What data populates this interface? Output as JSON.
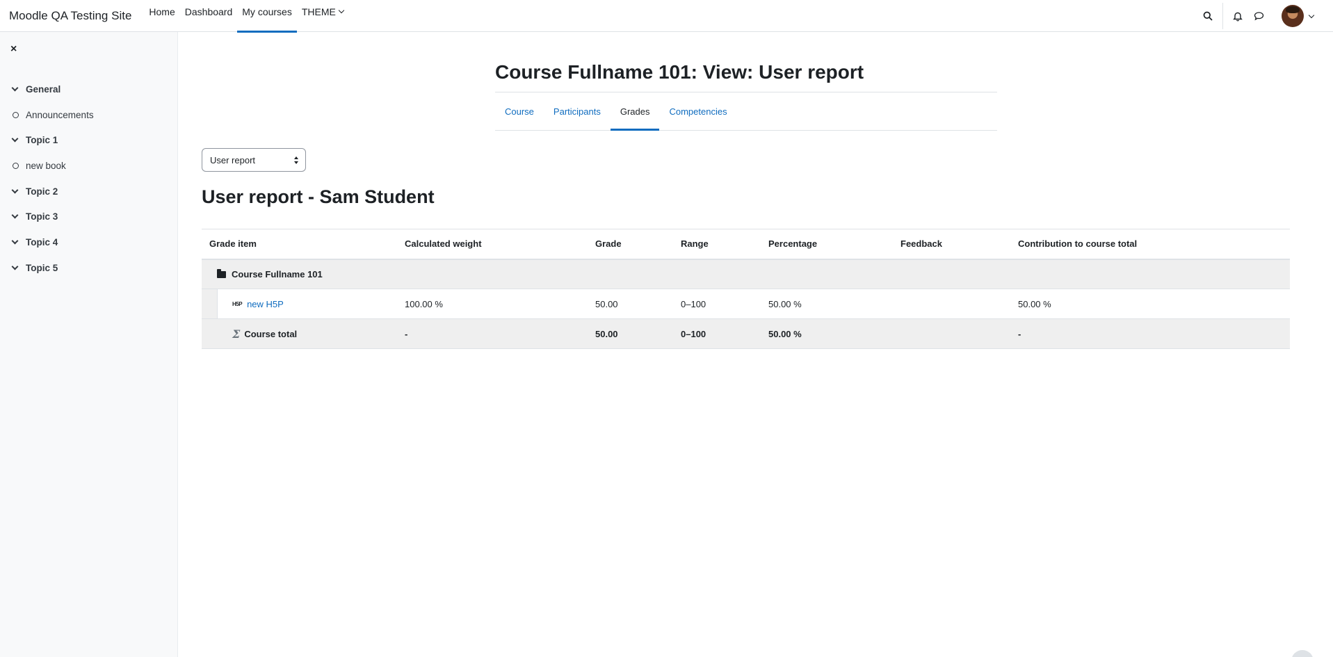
{
  "navbar": {
    "brand": "Moodle QA Testing Site",
    "links": [
      {
        "label": "Home"
      },
      {
        "label": "Dashboard"
      },
      {
        "label": "My courses"
      },
      {
        "label": "THEME"
      }
    ],
    "icons": [
      "search-icon",
      "bell-icon",
      "chat-icon",
      "avatar",
      "chevron-down-icon"
    ]
  },
  "drawer": {
    "close_icon": "×",
    "items": [
      {
        "type": "section",
        "label": "General"
      },
      {
        "type": "activity",
        "label": "Announcements"
      },
      {
        "type": "section",
        "label": "Topic 1"
      },
      {
        "type": "activity",
        "label": "new book"
      },
      {
        "type": "section",
        "label": "Topic 2"
      },
      {
        "type": "section",
        "label": "Topic 3"
      },
      {
        "type": "section",
        "label": "Topic 4"
      },
      {
        "type": "section",
        "label": "Topic 5"
      }
    ]
  },
  "header": {
    "title": "Course Fullname 101: View: User report",
    "tabs": [
      {
        "label": "Course"
      },
      {
        "label": "Participants"
      },
      {
        "label": "Grades"
      },
      {
        "label": "Competencies"
      }
    ]
  },
  "report_select": {
    "value": "User report"
  },
  "report_heading": "User report - Sam Student",
  "table": {
    "columns": [
      "Grade item",
      "Calculated weight",
      "Grade",
      "Range",
      "Percentage",
      "Feedback",
      "Contribution to course total"
    ],
    "category": {
      "name": "Course Fullname 101"
    },
    "item": {
      "icon": "H5P",
      "name": "new H5P",
      "weight": "100.00 %",
      "grade": "50.00",
      "range": "0–100",
      "percentage": "50.00 %",
      "feedback": "",
      "contribution": "50.00 %"
    },
    "total": {
      "name": "Course total",
      "weight": "-",
      "grade": "50.00",
      "range": "0–100",
      "percentage": "50.00 %",
      "feedback": "",
      "contribution": "-"
    }
  }
}
